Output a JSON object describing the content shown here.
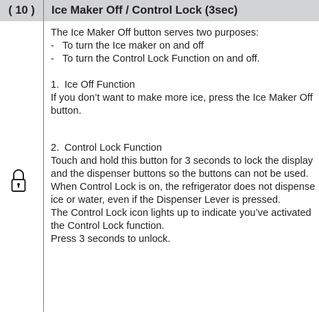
{
  "header": {
    "number": "( 10 )",
    "title": "Ice Maker Off / Control Lock (3sec)"
  },
  "icon": "lock-icon",
  "content": {
    "intro": "The Ice Maker Off button serves two purposes:",
    "bullets": [
      {
        "dash": "-",
        "text": "To turn the Ice maker on and off"
      },
      {
        "dash": "-",
        "text": "To turn the Control Lock Function on and off."
      }
    ],
    "section1": {
      "number": "1.",
      "heading": "Ice Off Function",
      "body": "If you don’t want to make more ice, press the Ice Maker Off button."
    },
    "section2": {
      "number": "2.",
      "heading": "Control Lock Function",
      "para1": "Touch and hold this button for 3 seconds to lock the display and the dispenser buttons so the buttons can not be used.",
      "para2": "When Control Lock is on, the refrigerator does not dispense ice or water, even if the Dispenser Lever is pressed.",
      "para3": "The Control Lock icon lights up to indicate you’ve activated the Control Lock function.",
      "para4": "Press 3 seconds to unlock."
    }
  }
}
